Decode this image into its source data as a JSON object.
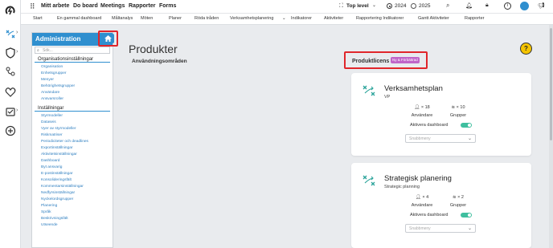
{
  "topnav": {
    "items": [
      "Mitt arbete",
      "Do board",
      "Meetings",
      "Rapporter",
      "Forms"
    ],
    "level_label": "Top level",
    "year_2024": "2024",
    "year_2025": "2025"
  },
  "subnav": {
    "items": [
      "Start",
      "En gammal dashboard",
      "Måltanalys",
      "Möten",
      "Planer",
      "Röda tråden",
      "Verksamhetsplanering",
      "Indikatorer",
      "Aktiviteter",
      "Rapportering Indikatorer",
      "Gantt Aktiviteter",
      "Rapporter"
    ]
  },
  "admin": {
    "title": "Administration",
    "search_placeholder": "Sök...",
    "section1": "Organisationsinställningar",
    "links1": [
      "Organisation",
      "Enhetsgrupper",
      "Menyer",
      "Behörighetsgrupper",
      "Användare",
      "Ansvarsroller"
    ],
    "section2": "Inställningar",
    "links2": [
      "Styrmodeller",
      "Dataseis",
      "Vyer av styrmodeller",
      "Riskmatriser",
      "Periodiciteter och deadlines",
      "Exportinställningar",
      "Aktivitetsinställningar",
      "Dashboard",
      "Byt ansvarig",
      "E-postinställningar",
      "Konsolideringsfält",
      "Kommentarsinställningar",
      "Nedfyrsinställningar",
      "Nyckelordsgrupper",
      "Planering",
      "Språk",
      "Beskrivningsfält",
      "Utseende"
    ]
  },
  "main": {
    "title": "Produkter",
    "usage_areas": "Användningsområden",
    "product_license": "Produktlicens",
    "badge": "Ny & Förbättrad"
  },
  "cards": [
    {
      "title": "Verksamhetsplan",
      "subtitle": "VP",
      "users_count": "× 18",
      "users_label": "Användare",
      "groups_count": "× 10",
      "groups_label": "Grupper",
      "dashboard_label": "Aktivera dashboard",
      "quickmenu": "Snabbmeny"
    },
    {
      "title": "Strategisk planering",
      "subtitle": "Strategic planning",
      "users_count": "× 4",
      "users_label": "Användare",
      "groups_count": "× 2",
      "groups_label": "Grupper",
      "dashboard_label": "Aktivera dashboard",
      "quickmenu": "Snabbmeny"
    }
  ],
  "colors": {
    "accent": "#2f8fcf",
    "highlight": "#e0262b",
    "badge": "#c064c8",
    "toggle": "#3fbf9f",
    "help": "#f5c400"
  }
}
